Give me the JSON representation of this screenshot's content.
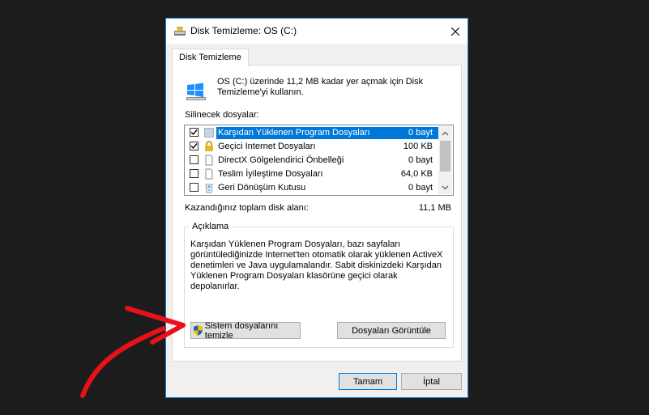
{
  "window": {
    "title": "Disk Temizleme: OS (C:)",
    "icon": "disk-cleanup-icon"
  },
  "tab": {
    "label": "Disk Temizleme"
  },
  "intro": {
    "text": "OS (C:) üzerinde 11,2 MB kadar yer açmak için Disk Temizleme'yi kullanın."
  },
  "files_label": "Silinecek dosyalar:",
  "files": [
    {
      "name": "Karşıdan Yüklenen Program Dosyaları",
      "size": "0 bayt",
      "checked": true,
      "selected": true,
      "icon": "folder-icon"
    },
    {
      "name": "Geçici Internet Dosyaları",
      "size": "100 KB",
      "checked": true,
      "selected": false,
      "icon": "lock-icon"
    },
    {
      "name": "DirectX Gölgelendirici Önbelleği",
      "size": "0 bayt",
      "checked": false,
      "selected": false,
      "icon": "file-icon"
    },
    {
      "name": "Teslim İyileştime Dosyaları",
      "size": "64,0 KB",
      "checked": false,
      "selected": false,
      "icon": "file-icon"
    },
    {
      "name": "Geri Dönüşüm Kutusu",
      "size": "0 bayt",
      "checked": false,
      "selected": false,
      "icon": "recycle-bin-icon"
    }
  ],
  "total": {
    "label": "Kazandığınız toplam disk alanı:",
    "value": "11,1 MB"
  },
  "description": {
    "title": "Açıklama",
    "text": "Karşıdan Yüklenen Program Dosyaları, bazı sayfaları görüntülediğinizde Internet'ten otomatik olarak yüklenen ActiveX denetimleri ve Java uygulamalandır. Sabit diskinizdeki Karşıdan Yüklenen Program Dosyaları klasörüne geçici olarak depolanırlar."
  },
  "buttons": {
    "clean_system": "Sistem dosyalarını temizle",
    "view_files": "Dosyaları Görüntüle",
    "ok": "Tamam",
    "cancel": "İptal"
  },
  "colors": {
    "accent": "#0078d7",
    "annotation_arrow": "#e8101a",
    "background": "#1c1c1c"
  }
}
